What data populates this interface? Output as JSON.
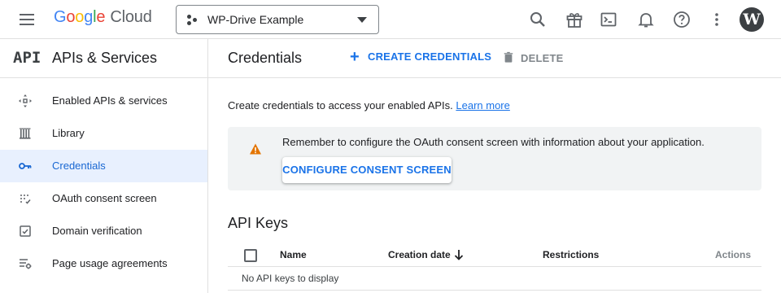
{
  "header": {
    "logo_word": "Google",
    "logo_letters": [
      "G",
      "o",
      "o",
      "g",
      "l",
      "e"
    ],
    "logo_colors": [
      "#4285F4",
      "#EA4335",
      "#FBBC05",
      "#4285F4",
      "#34A853",
      "#EA4335"
    ],
    "logo_product": "Cloud",
    "project_name": "WP-Drive Example",
    "icons": [
      "menu-icon",
      "search-icon",
      "gift-icon",
      "cloud-shell-icon",
      "notifications-icon",
      "help-icon",
      "more-vert-icon",
      "wordpress-avatar"
    ]
  },
  "sidebar": {
    "logo_text": "API",
    "title": "APIs & Services",
    "items": [
      {
        "label": "Enabled APIs & services",
        "icon": "enabled-apis-icon",
        "active": false
      },
      {
        "label": "Library",
        "icon": "library-icon",
        "active": false
      },
      {
        "label": "Credentials",
        "icon": "key-icon",
        "active": true
      },
      {
        "label": "OAuth consent screen",
        "icon": "oauth-consent-icon",
        "active": false
      },
      {
        "label": "Domain verification",
        "icon": "domain-verification-icon",
        "active": false
      },
      {
        "label": "Page usage agreements",
        "icon": "page-usage-icon",
        "active": false
      }
    ]
  },
  "main": {
    "page_title": "Credentials",
    "create_label": "CREATE CREDENTIALS",
    "delete_label": "DELETE",
    "intro_text": "Create credentials to access your enabled APIs.",
    "learn_more": "Learn more",
    "notice_text": "Remember to configure the OAuth consent screen with information about your application.",
    "configure_button": "CONFIGURE CONSENT SCREEN",
    "section_title": "API Keys",
    "table": {
      "columns": [
        "Name",
        "Creation date",
        "Restrictions",
        "Actions"
      ],
      "sorted_column": "Creation date",
      "sort_direction": "descending",
      "empty_text": "No API keys to display"
    }
  },
  "colors": {
    "accent": "#1a73e8",
    "active_bg": "#e8f0fe",
    "active_text": "#1967d2",
    "warning": "#e37400",
    "notice_bg": "#f1f3f4"
  }
}
